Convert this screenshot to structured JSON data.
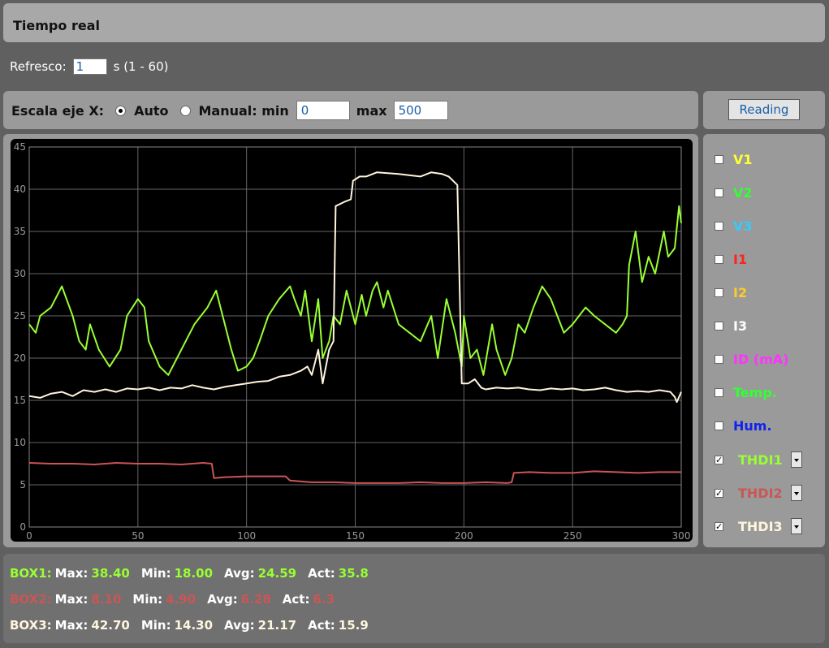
{
  "title": "Tiempo real",
  "refresh": {
    "label": "Refresco:",
    "value": "1",
    "range": "s (1 - 60)"
  },
  "xscale": {
    "label": "Escala eje X:",
    "auto_label": "Auto",
    "manual_label": "Manual: min",
    "min_value": "0",
    "max_label": "max",
    "max_value": "500",
    "selected": "Auto"
  },
  "reading_button": "Reading",
  "legend": [
    {
      "label": "V1",
      "color": "#ffff33",
      "checked": false
    },
    {
      "label": "V2",
      "color": "#33ff33",
      "checked": false
    },
    {
      "label": "V3",
      "color": "#33ccff",
      "checked": false
    },
    {
      "label": "I1",
      "color": "#ff2222",
      "checked": false
    },
    {
      "label": "I2",
      "color": "#ffcc22",
      "checked": false
    },
    {
      "label": "I3",
      "color": "#ffffff",
      "checked": false
    },
    {
      "label": "ID (mA)",
      "color": "#ff33ff",
      "checked": false
    },
    {
      "label": "Temp.",
      "color": "#33ff33",
      "checked": false
    },
    {
      "label": "Hum.",
      "color": "#1122ee",
      "checked": false
    },
    {
      "label": "THDI1",
      "color": "#99ff33",
      "checked": true
    },
    {
      "label": "THDI2",
      "color": "#cc5555",
      "checked": true
    },
    {
      "label": "THDI3",
      "color": "#fff5dd",
      "checked": true
    }
  ],
  "stats": [
    {
      "box": "BOX1:",
      "color": "#99ff33",
      "max": "38.40",
      "min": "18.00",
      "avg": "24.59",
      "act": "35.8"
    },
    {
      "box": "BOX2:",
      "color": "#cc5555",
      "max": "8.10",
      "min": "4.90",
      "avg": "6.28",
      "act": "6.3"
    },
    {
      "box": "BOX3:",
      "color": "#fff5dd",
      "max": "42.70",
      "min": "14.30",
      "avg": "21.17",
      "act": "15.9"
    }
  ],
  "stat_labels": {
    "max": "Max:",
    "min": "Min:",
    "avg": "Avg:",
    "act": "Act:"
  },
  "chart_data": {
    "type": "line",
    "xlim": [
      0,
      300
    ],
    "ylim": [
      0,
      45
    ],
    "xticks": [
      0,
      50,
      100,
      150,
      200,
      250,
      300
    ],
    "yticks": [
      0,
      5,
      10,
      15,
      20,
      25,
      30,
      35,
      40,
      45
    ],
    "grid": true,
    "series": [
      {
        "color": "#99ff33",
        "points": [
          [
            0,
            24
          ],
          [
            3,
            23
          ],
          [
            5,
            25
          ],
          [
            10,
            26
          ],
          [
            15,
            28.5
          ],
          [
            20,
            25
          ],
          [
            23,
            22
          ],
          [
            26,
            21
          ],
          [
            28,
            24
          ],
          [
            32,
            21
          ],
          [
            37,
            19
          ],
          [
            42,
            21
          ],
          [
            45,
            25
          ],
          [
            50,
            27
          ],
          [
            53,
            26
          ],
          [
            55,
            22
          ],
          [
            60,
            19
          ],
          [
            64,
            18
          ],
          [
            68,
            20
          ],
          [
            72,
            22
          ],
          [
            76,
            24
          ],
          [
            82,
            26
          ],
          [
            86,
            28
          ],
          [
            90,
            24
          ],
          [
            93,
            21
          ],
          [
            96,
            18.5
          ],
          [
            100,
            19
          ],
          [
            103,
            20
          ],
          [
            106,
            22
          ],
          [
            110,
            25
          ],
          [
            115,
            27
          ],
          [
            120,
            28.5
          ],
          [
            122,
            27
          ],
          [
            125,
            25
          ],
          [
            127,
            28
          ],
          [
            130,
            22
          ],
          [
            133,
            27
          ],
          [
            135,
            20
          ],
          [
            138,
            22
          ],
          [
            140,
            25
          ],
          [
            143,
            24
          ],
          [
            146,
            28
          ],
          [
            148,
            26
          ],
          [
            150,
            24
          ],
          [
            153,
            27.5
          ],
          [
            155,
            25
          ],
          [
            158,
            28
          ],
          [
            160,
            29
          ],
          [
            163,
            26
          ],
          [
            165,
            28
          ],
          [
            170,
            24
          ],
          [
            175,
            23
          ],
          [
            180,
            22
          ],
          [
            185,
            25
          ],
          [
            188,
            20
          ],
          [
            192,
            27
          ],
          [
            196,
            23
          ],
          [
            199,
            19
          ],
          [
            200,
            25
          ],
          [
            203,
            20
          ],
          [
            206,
            21
          ],
          [
            209,
            18
          ],
          [
            213,
            24
          ],
          [
            215,
            21
          ],
          [
            219,
            18
          ],
          [
            222,
            20
          ],
          [
            225,
            24
          ],
          [
            228,
            23
          ],
          [
            232,
            26
          ],
          [
            236,
            28.5
          ],
          [
            240,
            27
          ],
          [
            243,
            25
          ],
          [
            246,
            23
          ],
          [
            250,
            24
          ],
          [
            253,
            25
          ],
          [
            256,
            26
          ],
          [
            260,
            25
          ],
          [
            265,
            24
          ],
          [
            270,
            23
          ],
          [
            273,
            24
          ],
          [
            275,
            25
          ],
          [
            276,
            31
          ],
          [
            279,
            35
          ],
          [
            282,
            29
          ],
          [
            285,
            32
          ],
          [
            288,
            30
          ],
          [
            292,
            35
          ],
          [
            294,
            32
          ],
          [
            297,
            33
          ],
          [
            299,
            38
          ],
          [
            300,
            36
          ]
        ]
      },
      {
        "color": "#cc5555",
        "points": [
          [
            0,
            7.6
          ],
          [
            10,
            7.5
          ],
          [
            20,
            7.5
          ],
          [
            30,
            7.4
          ],
          [
            40,
            7.6
          ],
          [
            50,
            7.5
          ],
          [
            60,
            7.5
          ],
          [
            70,
            7.4
          ],
          [
            80,
            7.6
          ],
          [
            84,
            7.5
          ],
          [
            85,
            5.8
          ],
          [
            90,
            5.9
          ],
          [
            100,
            6
          ],
          [
            110,
            6
          ],
          [
            118,
            6
          ],
          [
            120,
            5.5
          ],
          [
            130,
            5.3
          ],
          [
            140,
            5.3
          ],
          [
            150,
            5.2
          ],
          [
            160,
            5.2
          ],
          [
            170,
            5.2
          ],
          [
            180,
            5.3
          ],
          [
            190,
            5.2
          ],
          [
            200,
            5.2
          ],
          [
            210,
            5.3
          ],
          [
            220,
            5.2
          ],
          [
            222,
            5.3
          ],
          [
            223,
            6.4
          ],
          [
            230,
            6.5
          ],
          [
            240,
            6.4
          ],
          [
            250,
            6.4
          ],
          [
            260,
            6.6
          ],
          [
            270,
            6.5
          ],
          [
            280,
            6.4
          ],
          [
            290,
            6.5
          ],
          [
            300,
            6.5
          ]
        ]
      },
      {
        "color": "#fff5dd",
        "points": [
          [
            0,
            15.5
          ],
          [
            5,
            15.3
          ],
          [
            10,
            15.8
          ],
          [
            15,
            16
          ],
          [
            20,
            15.5
          ],
          [
            25,
            16.2
          ],
          [
            30,
            16
          ],
          [
            35,
            16.3
          ],
          [
            40,
            16
          ],
          [
            45,
            16.4
          ],
          [
            50,
            16.3
          ],
          [
            55,
            16.5
          ],
          [
            60,
            16.2
          ],
          [
            65,
            16.5
          ],
          [
            70,
            16.4
          ],
          [
            75,
            16.8
          ],
          [
            80,
            16.5
          ],
          [
            85,
            16.3
          ],
          [
            90,
            16.6
          ],
          [
            95,
            16.8
          ],
          [
            100,
            17
          ],
          [
            105,
            17.2
          ],
          [
            110,
            17.3
          ],
          [
            115,
            17.8
          ],
          [
            120,
            18
          ],
          [
            125,
            18.5
          ],
          [
            128,
            19
          ],
          [
            130,
            18
          ],
          [
            133,
            21
          ],
          [
            135,
            17
          ],
          [
            138,
            21
          ],
          [
            140,
            22
          ],
          [
            141,
            38
          ],
          [
            145,
            38.5
          ],
          [
            148,
            38.8
          ],
          [
            149,
            41
          ],
          [
            152,
            41.5
          ],
          [
            155,
            41.5
          ],
          [
            160,
            42
          ],
          [
            170,
            41.8
          ],
          [
            180,
            41.5
          ],
          [
            185,
            42
          ],
          [
            190,
            41.8
          ],
          [
            193,
            41.5
          ],
          [
            197,
            40.5
          ],
          [
            199,
            17
          ],
          [
            202,
            17
          ],
          [
            205,
            17.5
          ],
          [
            208,
            16.5
          ],
          [
            210,
            16.3
          ],
          [
            215,
            16.5
          ],
          [
            220,
            16.4
          ],
          [
            225,
            16.5
          ],
          [
            230,
            16.3
          ],
          [
            235,
            16.2
          ],
          [
            240,
            16.4
          ],
          [
            245,
            16.3
          ],
          [
            250,
            16.4
          ],
          [
            255,
            16.2
          ],
          [
            260,
            16.3
          ],
          [
            265,
            16.5
          ],
          [
            270,
            16.2
          ],
          [
            275,
            16
          ],
          [
            280,
            16.1
          ],
          [
            285,
            16
          ],
          [
            290,
            16.2
          ],
          [
            295,
            16
          ],
          [
            297,
            15.4
          ],
          [
            298,
            14.8
          ],
          [
            300,
            16
          ]
        ]
      }
    ]
  }
}
